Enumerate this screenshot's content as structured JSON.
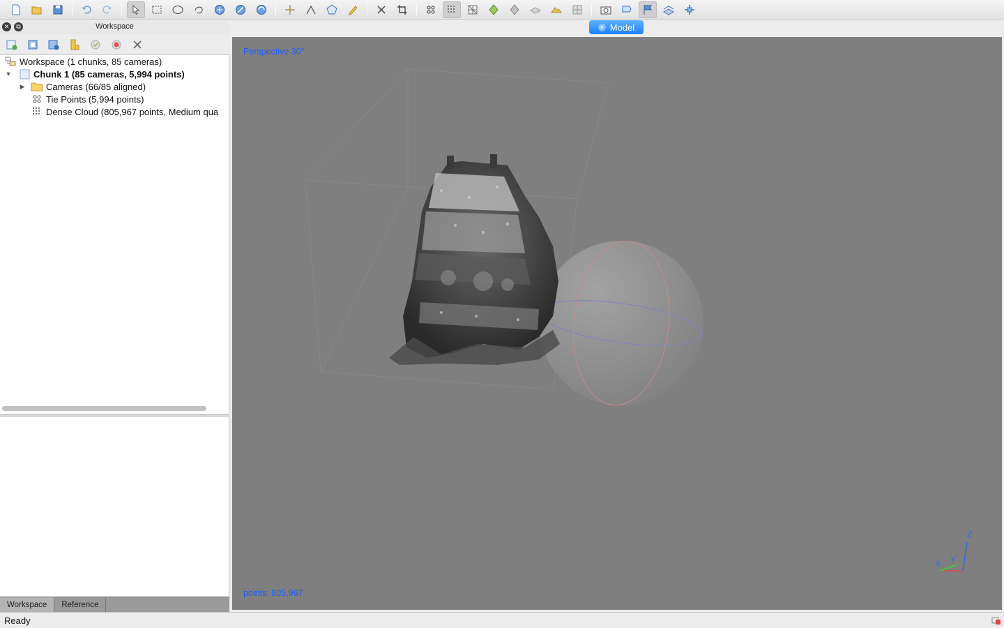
{
  "toolbar": {
    "icons": [
      "new-icon",
      "open-icon",
      "save-icon",
      "undo-icon",
      "redo-icon",
      "navigation-icon",
      "rectangle-selection-icon",
      "circle-selection-icon",
      "free-form-selection-icon",
      "resize-region-icon",
      "move-region-icon",
      "rotate-region-icon",
      "ruler-icon",
      "shape-icon",
      "polygon-icon",
      "draw-icon",
      "delete-selection-icon",
      "crop-icon",
      "tie-points-icon",
      "dense-cloud-icon",
      "wireframe-icon",
      "solid-icon",
      "textured-icon",
      "tiled-model-icon",
      "dem-icon",
      "orthomosaic-icon",
      "show-cameras-icon",
      "show-markers-icon",
      "show-shapes-icon",
      "show-region-icon",
      "reset-view-icon"
    ]
  },
  "panel": {
    "title": "Workspace",
    "tabs": [
      "Workspace",
      "Reference"
    ]
  },
  "tree": {
    "workspace": "Workspace (1 chunks, 85 cameras)",
    "chunk": "Chunk 1 (85 cameras, 5,994 points)",
    "cameras": "Cameras (66/85 aligned)",
    "tie_points": "Tie Points (5,994 points)",
    "dense_cloud": "Dense Cloud (805,967 points, Medium qua"
  },
  "viewport": {
    "tab_label": "Model",
    "perspective": "Perspective 30°",
    "points": "points: 805,967",
    "axis_labels": {
      "x": "X",
      "y": "Y",
      "z": "Z"
    }
  },
  "status": {
    "text": "Ready"
  }
}
